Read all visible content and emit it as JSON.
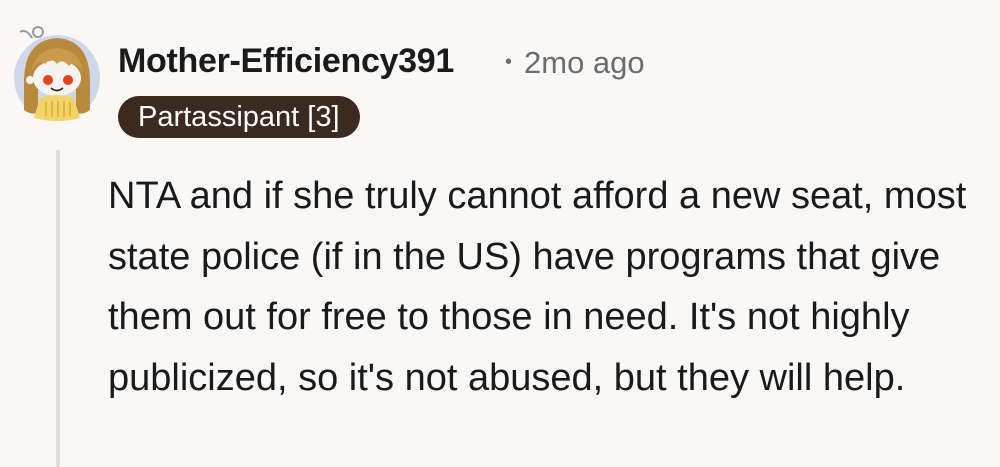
{
  "comment": {
    "author": "Mother-Efficiency391",
    "separator": "•",
    "timestamp": "2mo ago",
    "flair": "Partassipant [3]",
    "body": "NTA and if she truly cannot afford a new seat, most state police (if in the US) have programs that give them out for free to those in need. It's not highly publicized, so it's not abused, but they will help."
  },
  "colors": {
    "background": "#f9f8f7",
    "flair_bg": "#3b2a20",
    "flair_text": "#ffffff",
    "meta_text": "#6a6d70",
    "thread_line": "#e3ddd9"
  },
  "icons": {
    "avatar": "snoo-avatar-icon"
  }
}
